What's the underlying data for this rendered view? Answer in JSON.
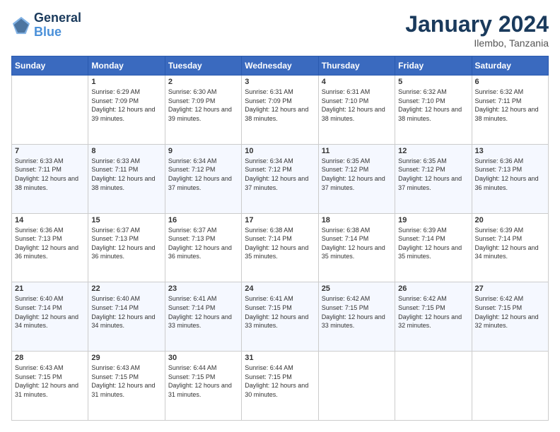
{
  "logo": {
    "line1": "General",
    "line2": "Blue"
  },
  "title": "January 2024",
  "location": "Ilembo, Tanzania",
  "days_header": [
    "Sunday",
    "Monday",
    "Tuesday",
    "Wednesday",
    "Thursday",
    "Friday",
    "Saturday"
  ],
  "weeks": [
    [
      {
        "day": "",
        "sunrise": "",
        "sunset": "",
        "daylight": ""
      },
      {
        "day": "1",
        "sunrise": "Sunrise: 6:29 AM",
        "sunset": "Sunset: 7:09 PM",
        "daylight": "Daylight: 12 hours and 39 minutes."
      },
      {
        "day": "2",
        "sunrise": "Sunrise: 6:30 AM",
        "sunset": "Sunset: 7:09 PM",
        "daylight": "Daylight: 12 hours and 39 minutes."
      },
      {
        "day": "3",
        "sunrise": "Sunrise: 6:31 AM",
        "sunset": "Sunset: 7:09 PM",
        "daylight": "Daylight: 12 hours and 38 minutes."
      },
      {
        "day": "4",
        "sunrise": "Sunrise: 6:31 AM",
        "sunset": "Sunset: 7:10 PM",
        "daylight": "Daylight: 12 hours and 38 minutes."
      },
      {
        "day": "5",
        "sunrise": "Sunrise: 6:32 AM",
        "sunset": "Sunset: 7:10 PM",
        "daylight": "Daylight: 12 hours and 38 minutes."
      },
      {
        "day": "6",
        "sunrise": "Sunrise: 6:32 AM",
        "sunset": "Sunset: 7:11 PM",
        "daylight": "Daylight: 12 hours and 38 minutes."
      }
    ],
    [
      {
        "day": "7",
        "sunrise": "Sunrise: 6:33 AM",
        "sunset": "Sunset: 7:11 PM",
        "daylight": "Daylight: 12 hours and 38 minutes."
      },
      {
        "day": "8",
        "sunrise": "Sunrise: 6:33 AM",
        "sunset": "Sunset: 7:11 PM",
        "daylight": "Daylight: 12 hours and 38 minutes."
      },
      {
        "day": "9",
        "sunrise": "Sunrise: 6:34 AM",
        "sunset": "Sunset: 7:12 PM",
        "daylight": "Daylight: 12 hours and 37 minutes."
      },
      {
        "day": "10",
        "sunrise": "Sunrise: 6:34 AM",
        "sunset": "Sunset: 7:12 PM",
        "daylight": "Daylight: 12 hours and 37 minutes."
      },
      {
        "day": "11",
        "sunrise": "Sunrise: 6:35 AM",
        "sunset": "Sunset: 7:12 PM",
        "daylight": "Daylight: 12 hours and 37 minutes."
      },
      {
        "day": "12",
        "sunrise": "Sunrise: 6:35 AM",
        "sunset": "Sunset: 7:12 PM",
        "daylight": "Daylight: 12 hours and 37 minutes."
      },
      {
        "day": "13",
        "sunrise": "Sunrise: 6:36 AM",
        "sunset": "Sunset: 7:13 PM",
        "daylight": "Daylight: 12 hours and 36 minutes."
      }
    ],
    [
      {
        "day": "14",
        "sunrise": "Sunrise: 6:36 AM",
        "sunset": "Sunset: 7:13 PM",
        "daylight": "Daylight: 12 hours and 36 minutes."
      },
      {
        "day": "15",
        "sunrise": "Sunrise: 6:37 AM",
        "sunset": "Sunset: 7:13 PM",
        "daylight": "Daylight: 12 hours and 36 minutes."
      },
      {
        "day": "16",
        "sunrise": "Sunrise: 6:37 AM",
        "sunset": "Sunset: 7:13 PM",
        "daylight": "Daylight: 12 hours and 36 minutes."
      },
      {
        "day": "17",
        "sunrise": "Sunrise: 6:38 AM",
        "sunset": "Sunset: 7:14 PM",
        "daylight": "Daylight: 12 hours and 35 minutes."
      },
      {
        "day": "18",
        "sunrise": "Sunrise: 6:38 AM",
        "sunset": "Sunset: 7:14 PM",
        "daylight": "Daylight: 12 hours and 35 minutes."
      },
      {
        "day": "19",
        "sunrise": "Sunrise: 6:39 AM",
        "sunset": "Sunset: 7:14 PM",
        "daylight": "Daylight: 12 hours and 35 minutes."
      },
      {
        "day": "20",
        "sunrise": "Sunrise: 6:39 AM",
        "sunset": "Sunset: 7:14 PM",
        "daylight": "Daylight: 12 hours and 34 minutes."
      }
    ],
    [
      {
        "day": "21",
        "sunrise": "Sunrise: 6:40 AM",
        "sunset": "Sunset: 7:14 PM",
        "daylight": "Daylight: 12 hours and 34 minutes."
      },
      {
        "day": "22",
        "sunrise": "Sunrise: 6:40 AM",
        "sunset": "Sunset: 7:14 PM",
        "daylight": "Daylight: 12 hours and 34 minutes."
      },
      {
        "day": "23",
        "sunrise": "Sunrise: 6:41 AM",
        "sunset": "Sunset: 7:14 PM",
        "daylight": "Daylight: 12 hours and 33 minutes."
      },
      {
        "day": "24",
        "sunrise": "Sunrise: 6:41 AM",
        "sunset": "Sunset: 7:15 PM",
        "daylight": "Daylight: 12 hours and 33 minutes."
      },
      {
        "day": "25",
        "sunrise": "Sunrise: 6:42 AM",
        "sunset": "Sunset: 7:15 PM",
        "daylight": "Daylight: 12 hours and 33 minutes."
      },
      {
        "day": "26",
        "sunrise": "Sunrise: 6:42 AM",
        "sunset": "Sunset: 7:15 PM",
        "daylight": "Daylight: 12 hours and 32 minutes."
      },
      {
        "day": "27",
        "sunrise": "Sunrise: 6:42 AM",
        "sunset": "Sunset: 7:15 PM",
        "daylight": "Daylight: 12 hours and 32 minutes."
      }
    ],
    [
      {
        "day": "28",
        "sunrise": "Sunrise: 6:43 AM",
        "sunset": "Sunset: 7:15 PM",
        "daylight": "Daylight: 12 hours and 31 minutes."
      },
      {
        "day": "29",
        "sunrise": "Sunrise: 6:43 AM",
        "sunset": "Sunset: 7:15 PM",
        "daylight": "Daylight: 12 hours and 31 minutes."
      },
      {
        "day": "30",
        "sunrise": "Sunrise: 6:44 AM",
        "sunset": "Sunset: 7:15 PM",
        "daylight": "Daylight: 12 hours and 31 minutes."
      },
      {
        "day": "31",
        "sunrise": "Sunrise: 6:44 AM",
        "sunset": "Sunset: 7:15 PM",
        "daylight": "Daylight: 12 hours and 30 minutes."
      },
      {
        "day": "",
        "sunrise": "",
        "sunset": "",
        "daylight": ""
      },
      {
        "day": "",
        "sunrise": "",
        "sunset": "",
        "daylight": ""
      },
      {
        "day": "",
        "sunrise": "",
        "sunset": "",
        "daylight": ""
      }
    ]
  ]
}
